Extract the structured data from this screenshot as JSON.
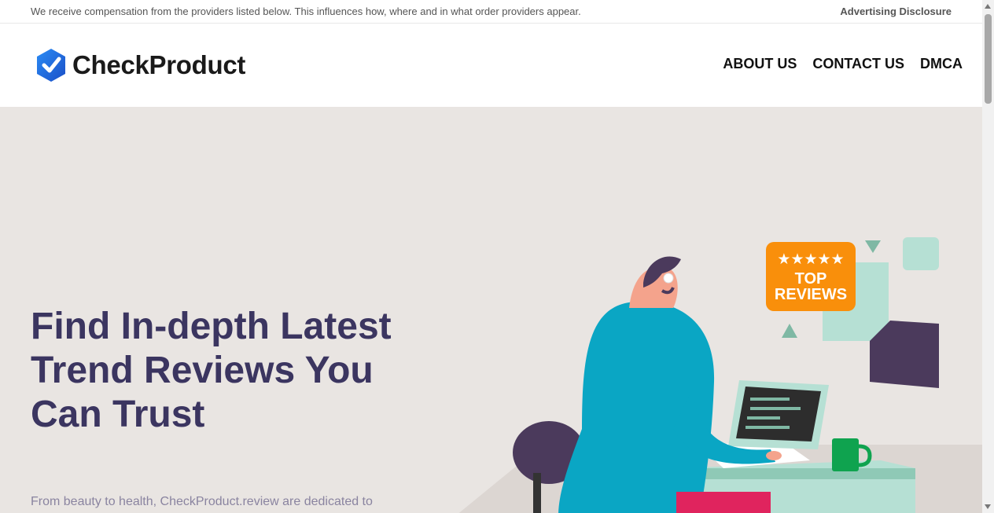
{
  "disclosure": {
    "text": "We receive compensation from the providers listed below. This influences how, where and in what order providers appear.",
    "link_label": "Advertising Disclosure"
  },
  "header": {
    "logo_text": "CheckProduct",
    "nav": [
      "ABOUT US",
      "CONTACT US",
      "DMCA"
    ]
  },
  "hero": {
    "title": "Find In-depth Latest Trend Reviews You Can Trust",
    "subtitle": "From beauty to health, CheckProduct.review are dedicated to",
    "badge_line1": "TOP",
    "badge_line2": "REVIEWS",
    "badge_stars": "★★★★★"
  },
  "colors": {
    "brand_blue": "#1f6fd9",
    "hero_bg": "#e9e5e2",
    "title": "#3b3560",
    "badge_orange": "#f98f0b"
  }
}
